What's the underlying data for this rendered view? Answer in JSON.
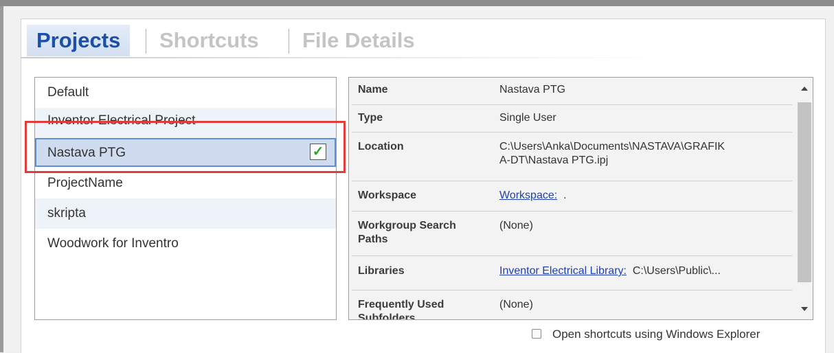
{
  "tabs": {
    "projects": "Projects",
    "shortcuts": "Shortcuts",
    "file_details": "File Details"
  },
  "projects": [
    {
      "name": "Default"
    },
    {
      "name": "Inventor Electrical Project"
    },
    {
      "name": "Nastava PTG",
      "selected": true,
      "checked": true
    },
    {
      "name": "ProjectName"
    },
    {
      "name": "skripta"
    },
    {
      "name": "Woodwork for Inventro"
    }
  ],
  "check_glyph": "✓",
  "properties": {
    "name": {
      "key": "Name",
      "value": "Nastava PTG"
    },
    "type": {
      "key": "Type",
      "value": "Single User"
    },
    "location": {
      "key": "Location",
      "value_line1": "C:\\Users\\Anka\\Documents\\NASTAVA\\GRAFIK",
      "value_line2": "A-DT\\Nastava PTG.ipj"
    },
    "workspace": {
      "key": "Workspace",
      "link": "Workspace:",
      "value": "."
    },
    "workgroup": {
      "key_line1": "Workgroup Search",
      "key_line2": "Paths",
      "value": "(None)"
    },
    "libraries": {
      "key": "Libraries",
      "link": "Inventor Electrical Library:",
      "value": "C:\\Users\\Public\\..."
    },
    "frequent": {
      "key_line1": "Frequently Used",
      "key_line2": "Subfolders",
      "value": "(None)"
    }
  },
  "footer": {
    "open_shortcuts_label": "Open shortcuts using Windows Explorer",
    "open_shortcuts_checked": false
  },
  "colors": {
    "active_tab": "#1b4fa8",
    "inactive_tab": "#c4c4c4",
    "selection": "#cfdcef",
    "highlight_border": "#e03c3c",
    "link": "#1f3fb4"
  }
}
